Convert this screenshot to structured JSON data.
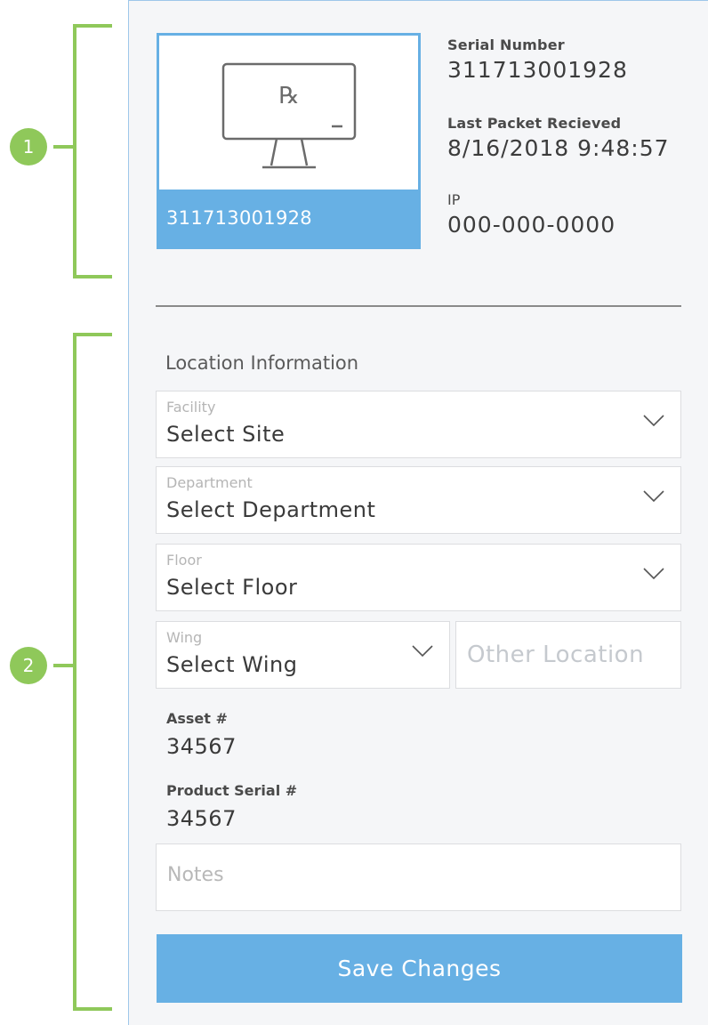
{
  "annotations": {
    "badge_1": "1",
    "badge_2": "2",
    "accent_color": "#8fc85a"
  },
  "device": {
    "card_serial": "311713001928",
    "icon": "monitor-rx-icon",
    "serial_label": "Serial Number",
    "serial_value": "311713001928",
    "packet_label": "Last Packet Recieved",
    "packet_value": "8/16/2018 9:48:57",
    "ip_label": "IP",
    "ip_value": "000-000-0000"
  },
  "location": {
    "section_title": "Location Information",
    "facility": {
      "label": "Facility",
      "value": "Select Site"
    },
    "department": {
      "label": "Department",
      "value": "Select Department"
    },
    "floor": {
      "label": "Floor",
      "value": "Select Floor"
    },
    "wing": {
      "label": "Wing",
      "value": "Select Wing"
    },
    "other_location_placeholder": "Other Location"
  },
  "asset": {
    "label": "Asset #",
    "value": "34567"
  },
  "product_serial": {
    "label": "Product Serial #",
    "value": "34567"
  },
  "notes_placeholder": "Notes",
  "save_label": "Save Changes",
  "colors": {
    "primary": "#67b0e4",
    "panel_bg": "#f5f6f8"
  }
}
